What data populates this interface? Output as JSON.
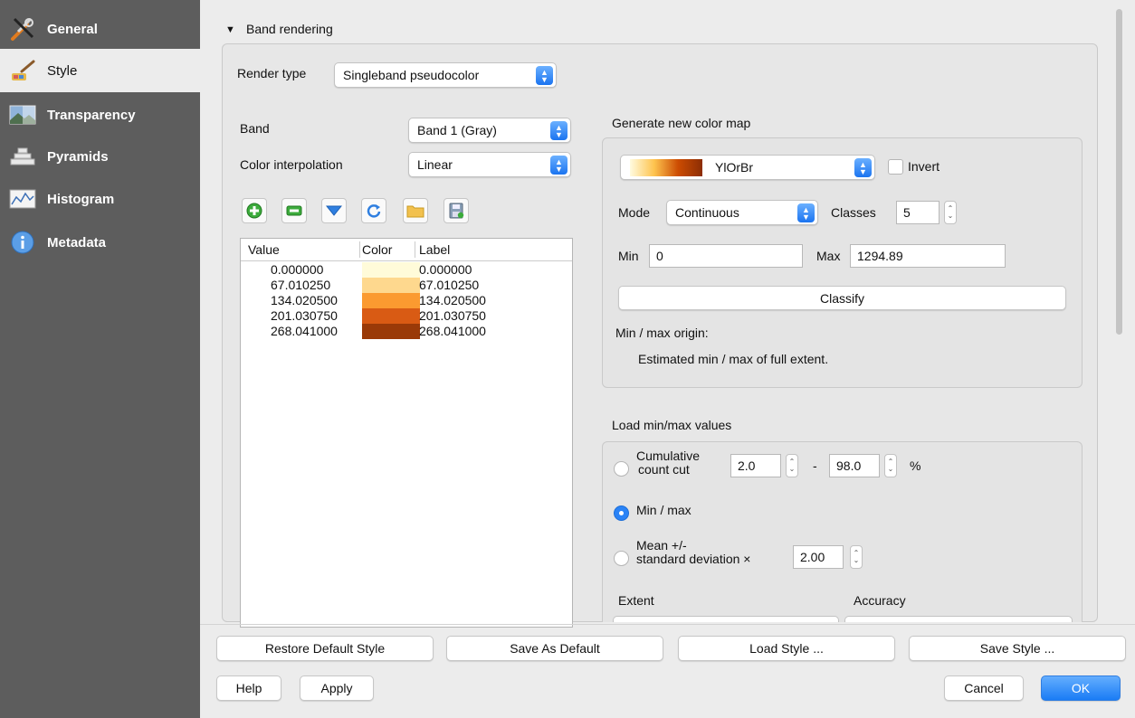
{
  "sidebar": {
    "items": [
      {
        "label": "General"
      },
      {
        "label": "Style"
      },
      {
        "label": "Transparency"
      },
      {
        "label": "Pyramids"
      },
      {
        "label": "Histogram"
      },
      {
        "label": "Metadata"
      }
    ],
    "active": "Style"
  },
  "band_rendering": {
    "section_title": "Band rendering",
    "render_type_label": "Render type",
    "render_type_value": "Singleband pseudocolor",
    "band_label": "Band",
    "band_value": "Band 1 (Gray)",
    "interp_label": "Color interpolation",
    "interp_value": "Linear"
  },
  "toolbar": {
    "icons": [
      "add-icon",
      "remove-icon",
      "down-arrow-icon",
      "refresh-icon",
      "folder-icon",
      "save-icon"
    ]
  },
  "color_table": {
    "headers": {
      "value": "Value",
      "color": "Color",
      "label": "Label"
    },
    "rows": [
      {
        "value": "0.000000",
        "color": "#fffbd9",
        "label": "0.000000"
      },
      {
        "value": "67.010250",
        "color": "#fed88e",
        "label": "67.010250"
      },
      {
        "value": "134.020500",
        "color": "#fb9a30",
        "label": "134.020500"
      },
      {
        "value": "201.030750",
        "color": "#d95b14",
        "label": "201.030750"
      },
      {
        "value": "268.041000",
        "color": "#9a3a08",
        "label": "268.041000"
      }
    ]
  },
  "generate": {
    "title": "Generate new color map",
    "ramp_name": "YlOrBr",
    "ramp_colors": [
      "#fffbe0",
      "#fec44f",
      "#cc4c02",
      "#8c2d04"
    ],
    "invert_label": "Invert",
    "mode_label": "Mode",
    "mode_value": "Continuous",
    "classes_label": "Classes",
    "classes_value": "5",
    "min_label": "Min",
    "min_value": "0",
    "max_label": "Max",
    "max_value": "1294.89",
    "classify_label": "Classify",
    "origin_label": "Min / max origin:",
    "origin_value": "Estimated min / max of full extent."
  },
  "load_minmax": {
    "title": "Load min/max values",
    "cumulative_label_1": "Cumulative",
    "cumulative_label_2": "count cut",
    "cum_low": "2.0",
    "dash": "-",
    "cum_high": "98.0",
    "percent": "%",
    "minmax_label": "Min / max",
    "selected": "Min / max",
    "mean_label_1": "Mean +/-",
    "mean_label_2": "standard deviation ×",
    "stddev_value": "2.00",
    "extent_label": "Extent",
    "accuracy_label": "Accuracy"
  },
  "footer": {
    "restore_default": "Restore Default Style",
    "save_as_default": "Save As Default",
    "load_style": "Load Style ...",
    "save_style": "Save Style ...",
    "help": "Help",
    "apply": "Apply",
    "cancel": "Cancel",
    "ok": "OK"
  },
  "colors": {
    "sidebar_bg": "#5d5d5d",
    "content_bg": "#ececec",
    "accent": "#1a7cf5"
  }
}
